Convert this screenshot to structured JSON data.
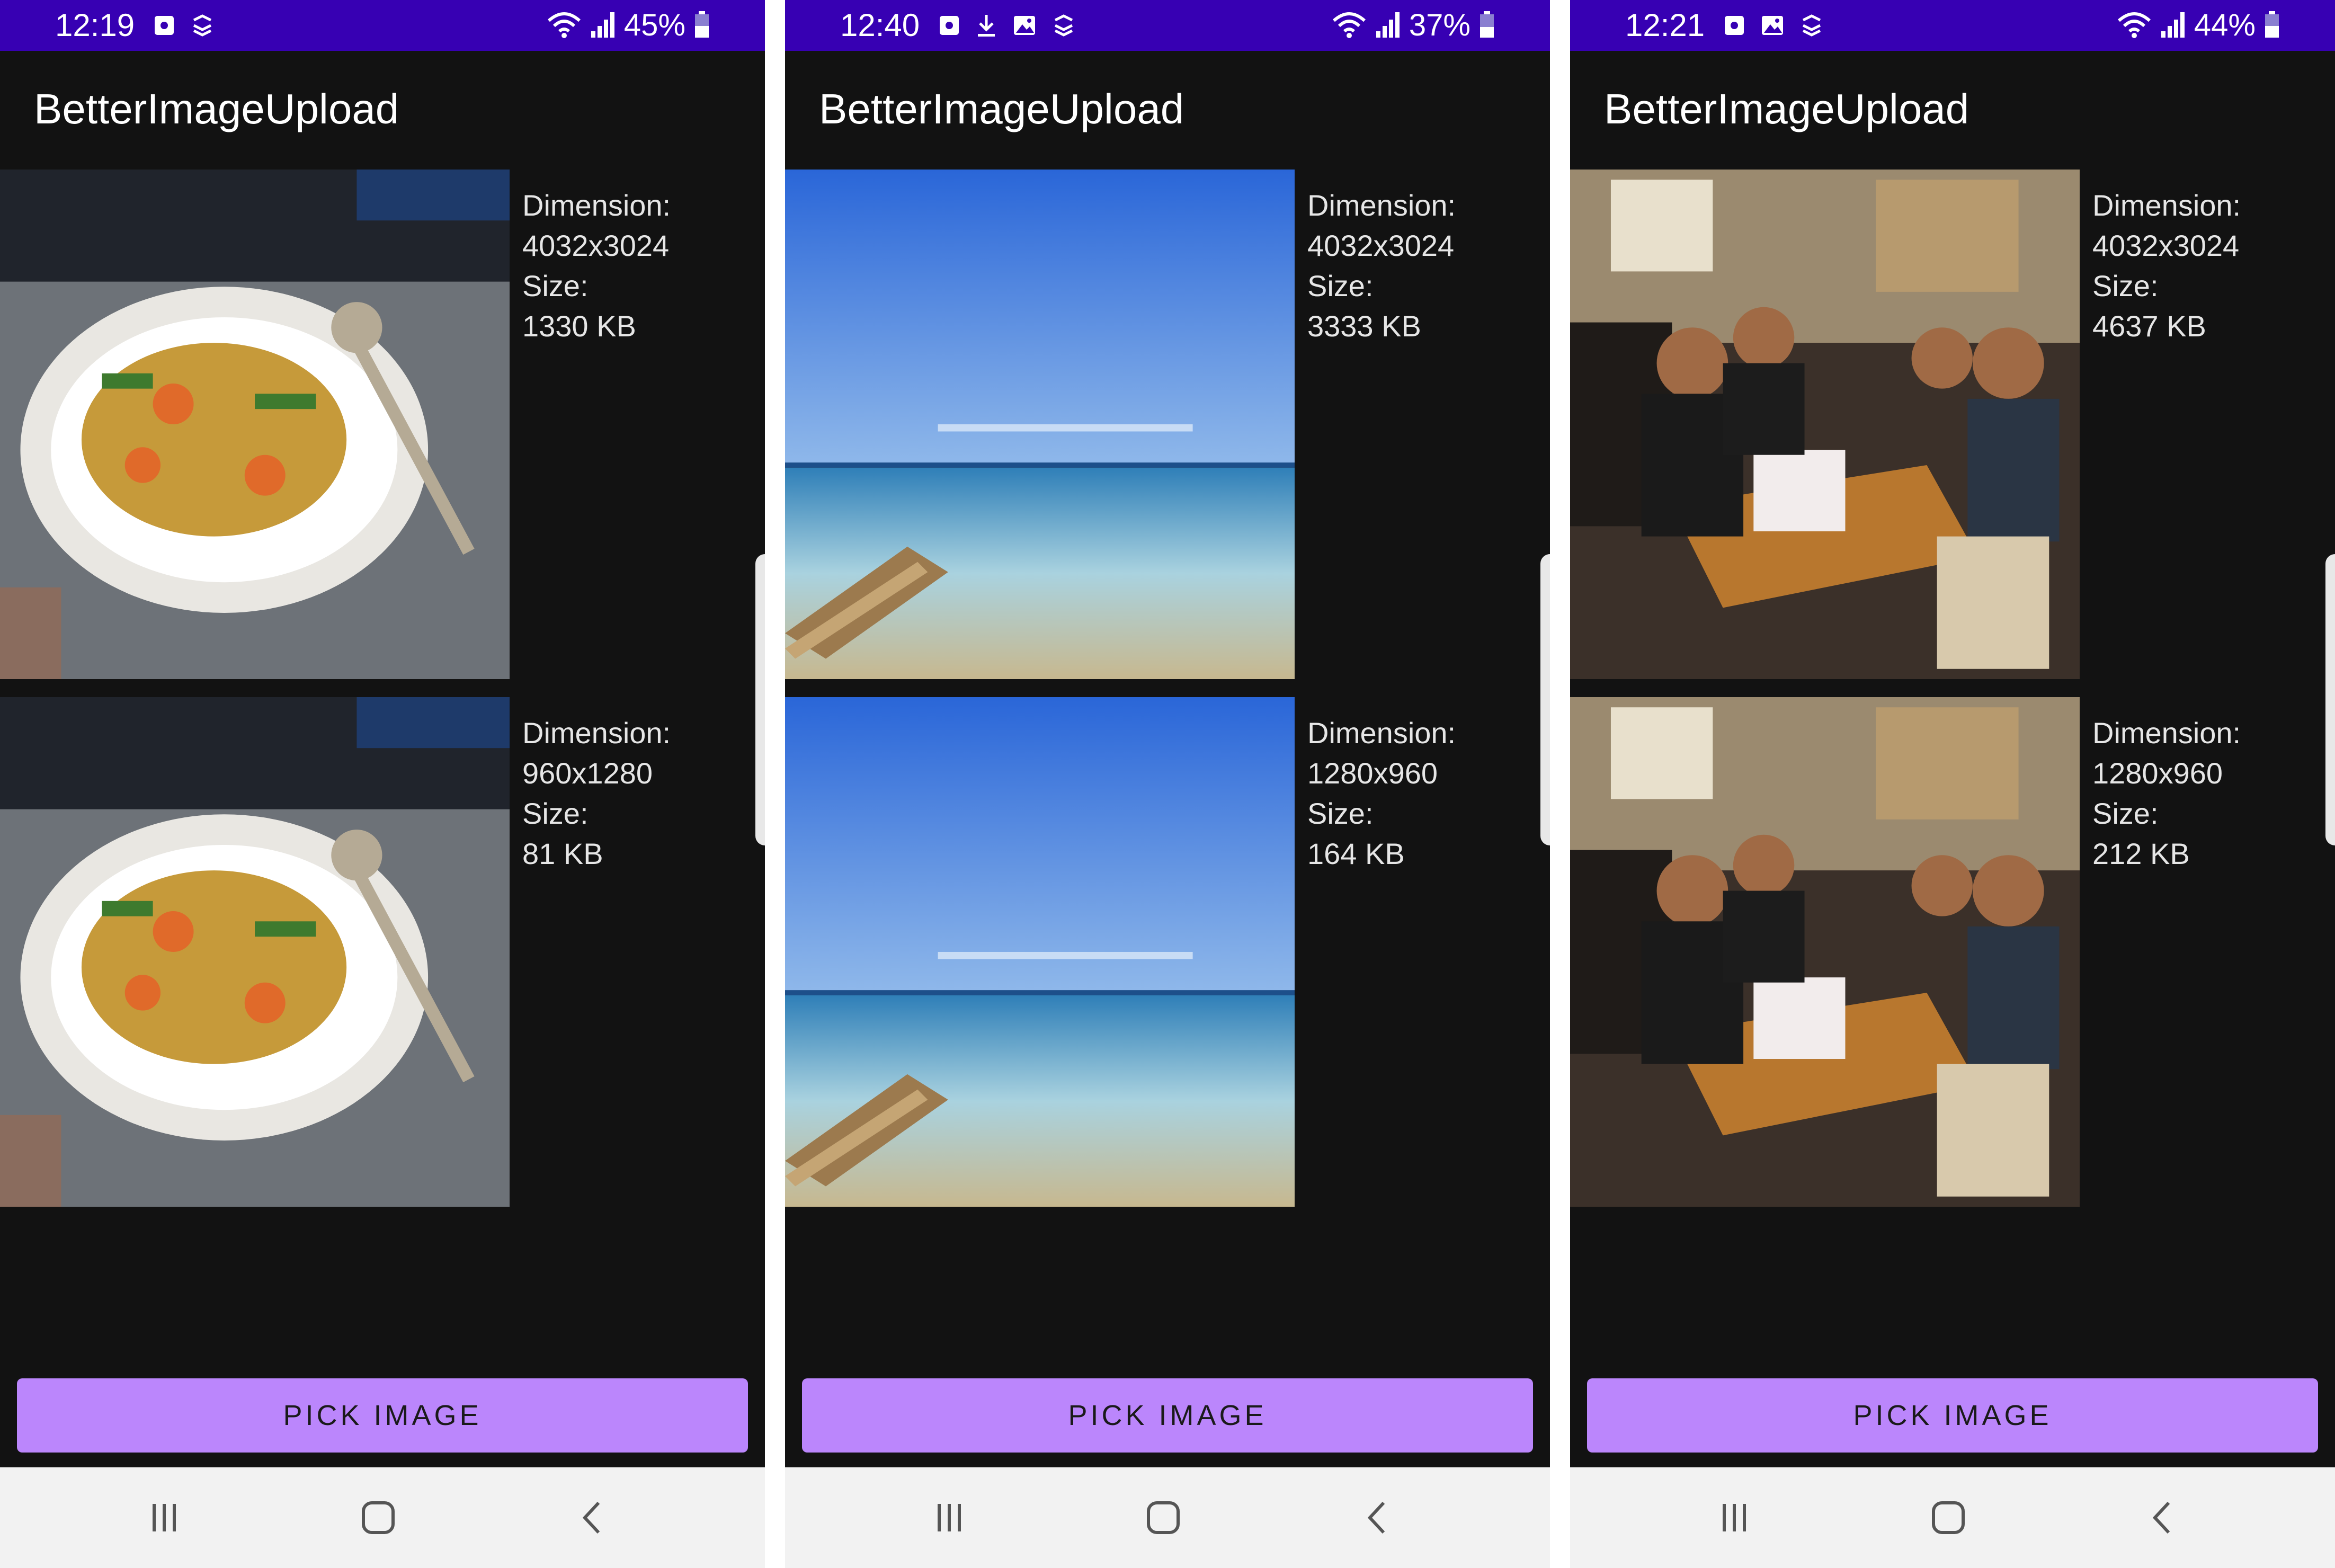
{
  "colors": {
    "status_bar": "#3700b3",
    "app_background": "#121212",
    "button": "#bb86fc",
    "nav_bar": "#f2f2f2"
  },
  "screens": [
    {
      "status": {
        "time": "12:19",
        "battery": "45%",
        "icons": [
          "screenshot-icon",
          "sync-icon"
        ]
      },
      "app_title": "BetterImageUpload",
      "images": [
        {
          "subject": "food",
          "label_dimension": "Dimension:",
          "dimension": "4032x3024",
          "label_size": "Size:",
          "size": "1330 KB"
        },
        {
          "subject": "food",
          "label_dimension": "Dimension:",
          "dimension": "960x1280",
          "label_size": "Size:",
          "size": "81 KB"
        }
      ],
      "button": "PICK IMAGE"
    },
    {
      "status": {
        "time": "12:40",
        "battery": "37%",
        "icons": [
          "screenshot-icon",
          "download-icon",
          "gallery-icon",
          "sync-icon"
        ]
      },
      "app_title": "BetterImageUpload",
      "images": [
        {
          "subject": "beach",
          "label_dimension": "Dimension:",
          "dimension": "4032x3024",
          "label_size": "Size:",
          "size": "3333 KB"
        },
        {
          "subject": "beach",
          "label_dimension": "Dimension:",
          "dimension": "1280x960",
          "label_size": "Size:",
          "size": "164 KB"
        }
      ],
      "button": "PICK IMAGE"
    },
    {
      "status": {
        "time": "12:21",
        "battery": "44%",
        "icons": [
          "screenshot-icon",
          "gallery-icon",
          "sync-icon"
        ]
      },
      "app_title": "BetterImageUpload",
      "images": [
        {
          "subject": "group-photo",
          "label_dimension": "Dimension:",
          "dimension": "4032x3024",
          "label_size": "Size:",
          "size": "4637 KB"
        },
        {
          "subject": "group-photo",
          "label_dimension": "Dimension:",
          "dimension": "1280x960",
          "label_size": "Size:",
          "size": "212 KB"
        }
      ],
      "button": "PICK IMAGE"
    }
  ],
  "nav_icons": [
    "recent-apps-icon",
    "home-icon",
    "back-icon"
  ]
}
